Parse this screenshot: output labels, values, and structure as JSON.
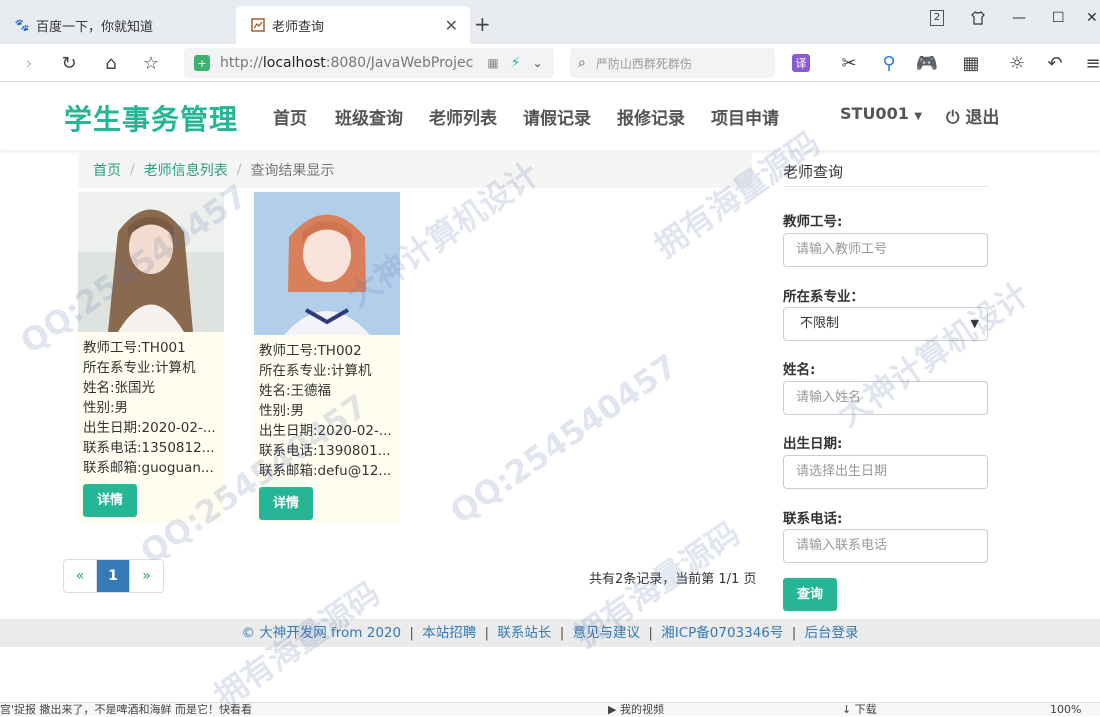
{
  "browser": {
    "tabs": [
      {
        "icon": "baidu-paw-icon",
        "title": "百度一下，你就知道"
      },
      {
        "icon": "page-favicon-icon",
        "title": "老师查询"
      }
    ],
    "url_prefix": "http://",
    "url_host": "localhost",
    "url_rest": ":8080/JavaWebProjec",
    "search_placeholder": "严防山西群死群伤",
    "window_badge": "2",
    "statusbar": {
      "news": "宫'捉报 撒出来了，不是啤酒和海鲜 而是它！快看看",
      "video": "我的视频",
      "download": "下载",
      "zoom": "100%"
    }
  },
  "site": {
    "brand": "学生事务管理",
    "nav": [
      "首页",
      "班级查询",
      "老师列表",
      "请假记录",
      "报修记录",
      "项目申请"
    ],
    "user": "STU001",
    "logout": "退出"
  },
  "breadcrumb": {
    "items": [
      "首页",
      "老师信息列表"
    ],
    "current": "查询结果显示"
  },
  "teachers": [
    {
      "id": "教师工号:TH001",
      "dept": "所在系专业:计算机",
      "name": "姓名:张国光",
      "gender": "性别:男",
      "birth": "出生日期:2020-02-...",
      "phone": "联系电话:1350812...",
      "email": "联系邮箱:guoguan...",
      "detail": "详情"
    },
    {
      "id": "教师工号:TH002",
      "dept": "所在系专业:计算机",
      "name": "姓名:王德福",
      "gender": "性别:男",
      "birth": "出生日期:2020-02-...",
      "phone": "联系电话:1390801...",
      "email": "联系邮箱:defu@12...",
      "detail": "详情"
    }
  ],
  "pagination": {
    "prev": "«",
    "current": "1",
    "next": "»",
    "summary": "共有2条记录，当前第 1/1 页"
  },
  "search": {
    "title": "老师查询",
    "teacher_no_label": "教师工号:",
    "teacher_no_placeholder": "请输入教师工号",
    "dept_label": "所在系专业：",
    "dept_value": "不限制",
    "name_label": "姓名:",
    "name_placeholder": "请输入姓名",
    "birth_label": "出生日期:",
    "birth_placeholder": "请选择出生日期",
    "phone_label": "联系电话:",
    "phone_placeholder": "请输入联系电话",
    "submit": "查询"
  },
  "footer": {
    "copyright": "© 大神开发网 from 2020",
    "links": [
      "本站招聘",
      "联系站长",
      "意见与建议",
      "湘ICP备0703346号",
      "后台登录"
    ]
  },
  "watermarks": [
    "QQ:254540457",
    "大神计算机设计",
    "拥有海量源码"
  ],
  "colors": {
    "accent": "#26b595",
    "link": "#337ab7",
    "active_page": "#337ab7",
    "card_bg": "#fffdf0"
  }
}
